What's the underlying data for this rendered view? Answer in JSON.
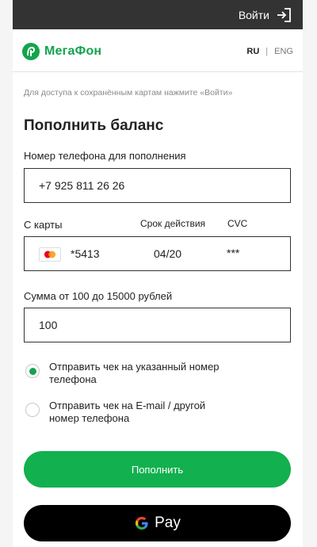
{
  "topbar": {
    "login_label": "Войти"
  },
  "header": {
    "logo_text": "МегаФон",
    "lang": {
      "ru": "RU",
      "separator": "|",
      "en": "ENG"
    }
  },
  "hint": "Для доступа к сохранённым картам нажмите «Войти»",
  "title": "Пополнить баланс",
  "phone": {
    "label": "Номер телефона для пополнения",
    "value": "+7 925 811 26 26"
  },
  "card": {
    "label": "С карты",
    "exp_label": "Срок действия",
    "cvc_label": "CVC",
    "number": "*5413",
    "exp": "04/20",
    "cvc": "***"
  },
  "amount": {
    "label": "Сумма от 100 до 15000 рублей",
    "value": "100"
  },
  "receipt": {
    "options": [
      {
        "label": "Отправить чек на указанный номер телефона",
        "checked": true
      },
      {
        "label": "Отправить чек на E-mail / другой номер телефона",
        "checked": false
      }
    ]
  },
  "buttons": {
    "pay_label": "Пополнить",
    "gpay_label": "Pay"
  },
  "colors": {
    "brand_green": "#12b04f",
    "topbar": "#333333",
    "gpay_bg": "#000000"
  },
  "icons": {
    "login": "login-arrow-icon",
    "logo": "megafon-logo-icon",
    "card": "mastercard-icon",
    "google": "google-g-icon"
  }
}
